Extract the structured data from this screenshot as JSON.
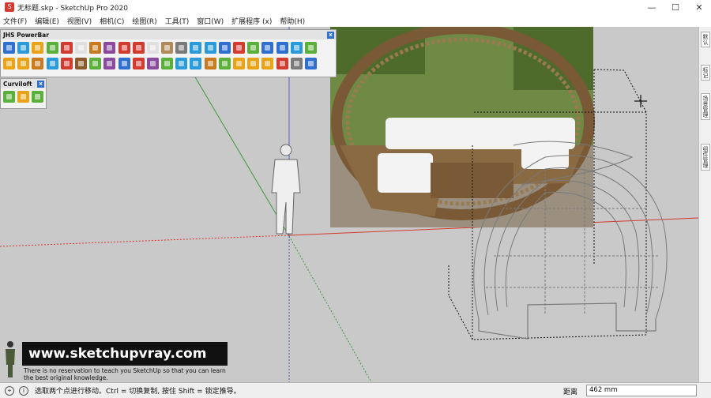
{
  "window": {
    "title": "无标题.skp - SketchUp Pro 2020",
    "minimize_glyph": "—",
    "maximize_glyph": "☐",
    "close_glyph": "✕"
  },
  "menubar": {
    "items": [
      {
        "label": "文件(F)"
      },
      {
        "label": "编辑(E)"
      },
      {
        "label": "视图(V)"
      },
      {
        "label": "相机(C)"
      },
      {
        "label": "绘图(R)"
      },
      {
        "label": "工具(T)"
      },
      {
        "label": "窗口(W)"
      },
      {
        "label": "扩展程序 (x)"
      },
      {
        "label": "帮助(H)"
      }
    ]
  },
  "powerbar": {
    "title": "JHS PowerBar",
    "close_glyph": "x",
    "row1_colors": [
      "#2f6fd0",
      "#2a9bd8",
      "#e8a317",
      "#5ab03a",
      "#d23b2f",
      "#e0e0e0",
      "#c87a1f",
      "#8b4a9e",
      "#d23b2f",
      "#d23b2f",
      "#e0e0e0",
      "#b08a5a",
      "#7a7a7a",
      "#2a9bd8",
      "#2a9bd8",
      "#2f6fd0",
      "#d23b2f",
      "#5ab03a",
      "#2f6fd0",
      "#2f6fd0",
      "#2a9bd8",
      "#5ab03a"
    ],
    "row2_colors": [
      "#e8a317",
      "#e8a317",
      "#c87a1f",
      "#2a9bd8",
      "#d23b2f",
      "#8b5a2b",
      "#5ab03a",
      "#8b4a9e",
      "#2f6fd0",
      "#d23b2f",
      "#8b4a9e",
      "#5ab03a",
      "#2a9bd8",
      "#2a9bd8",
      "#c87a1f",
      "#5ab03a",
      "#e8a317",
      "#e8a317",
      "#e8a317",
      "#d23b2f",
      "#7a7a7a",
      "#2f6fd0"
    ]
  },
  "curviloft": {
    "title": "Curviloft",
    "close_glyph": "x",
    "tool_colors": [
      "#5ab03a",
      "#e8a317",
      "#5ab03a"
    ]
  },
  "right_rail": {
    "tabs": [
      {
        "label": "默认"
      },
      {
        "label": "标记"
      },
      {
        "label": "场景管理"
      },
      {
        "label": "组件管理"
      }
    ]
  },
  "watermark": {
    "banner": "www.sketchupvray.com",
    "subtitle": "There is no reservation to teach you SketchUp so that you can learn the best original knowledge."
  },
  "status": {
    "message": "选取两个点进行移动。Ctrl = 切换复制, 按住 Shift = 锁定推导。",
    "measure_label": "距离",
    "measure_value": "462 mm"
  },
  "colors": {
    "axis_red": "#d23b2f",
    "axis_green": "#3a9a3a",
    "axis_blue": "#4a5bd0",
    "background": "#c9c9c9"
  }
}
